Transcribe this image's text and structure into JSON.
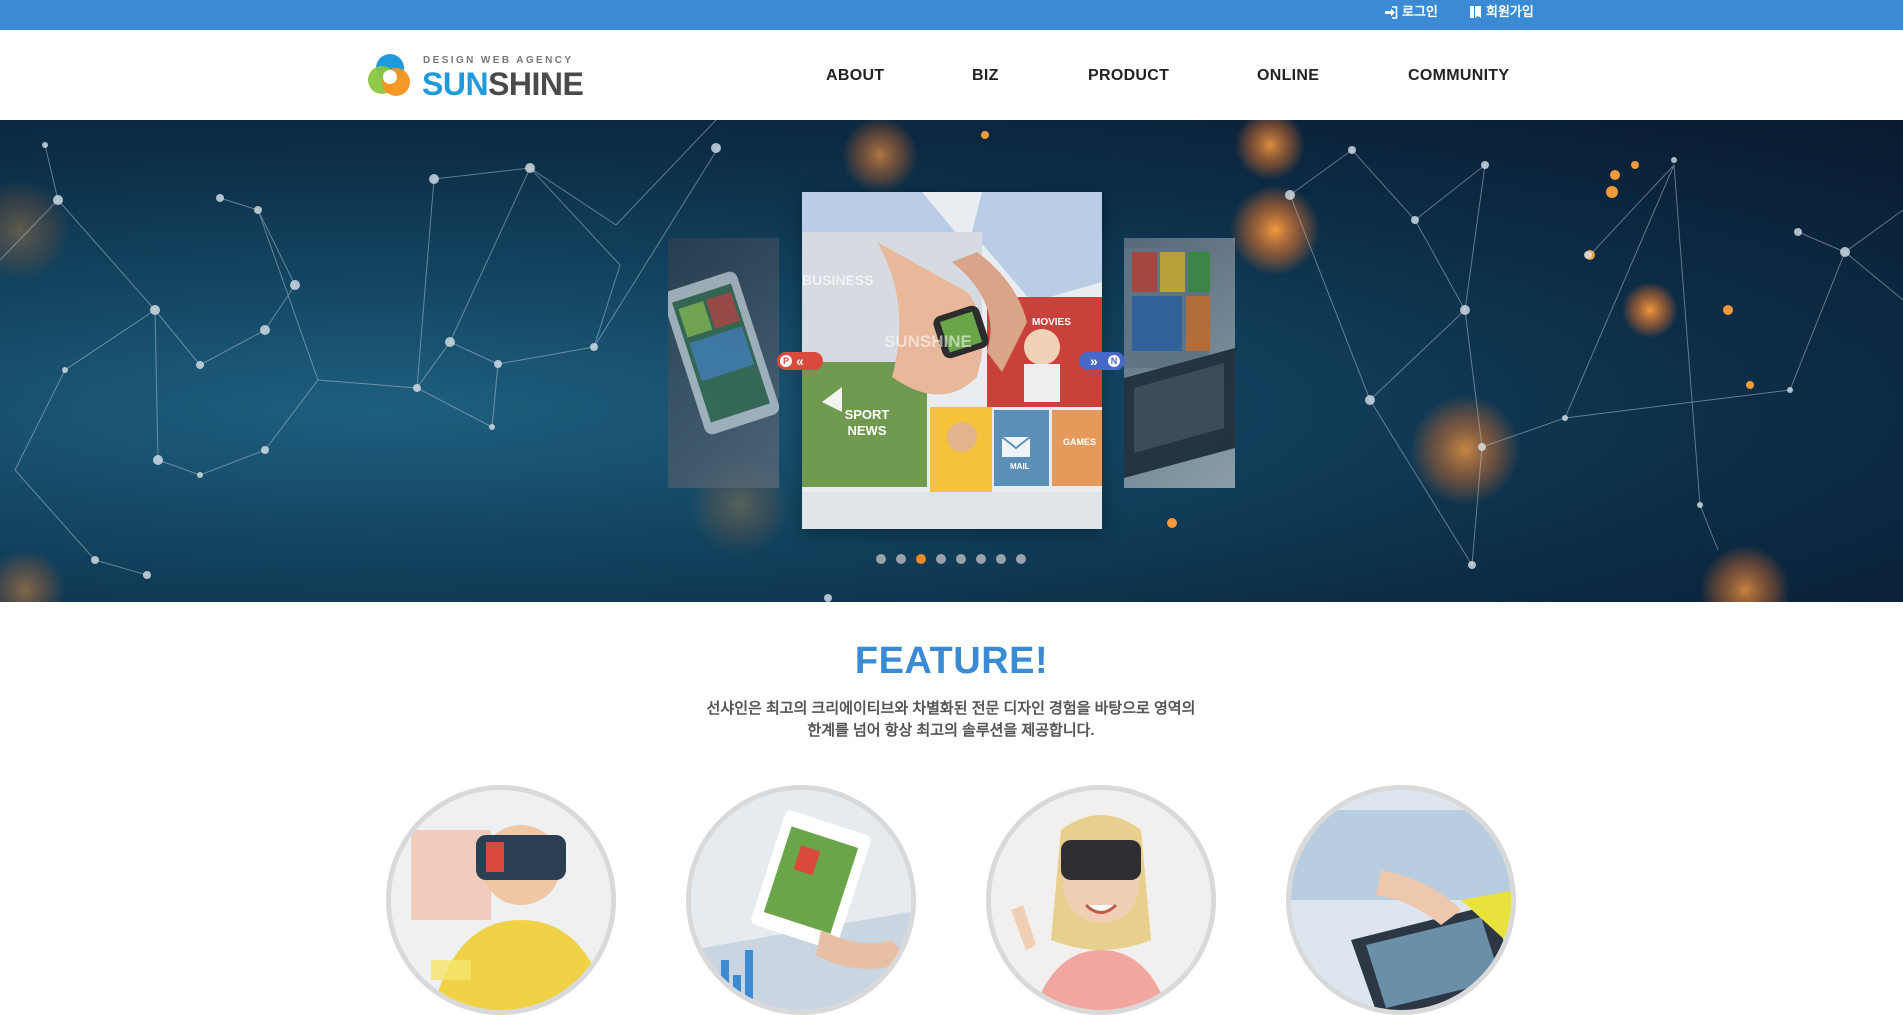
{
  "topbar": {
    "login_label": "로그인",
    "login_icon": "sign-in-icon",
    "signup_label": "회원가입",
    "signup_icon": "user-book-icon",
    "bg_color": "#3a8bd4"
  },
  "logo": {
    "tagline": "DESIGN WEB AGENCY",
    "word_part1": "SUN",
    "word_part2": "SHINE",
    "colors": {
      "sun": "#1f9bdc",
      "shine": "#4a4a4a"
    }
  },
  "nav": {
    "items": [
      "ABOUT",
      "BIZ",
      "PRODUCT",
      "ONLINE",
      "COMMUNITY"
    ]
  },
  "slider": {
    "prev_letter": "P",
    "next_letter": "N",
    "slide_labels": [
      "BUSINESS",
      "SUNSHINE",
      "MOVIES",
      "SPORT NEWS",
      "MAIL",
      "GAMES"
    ],
    "dot_count": 8,
    "active_dot": 3,
    "accent_color": "#f08a24"
  },
  "feature": {
    "title": "FEATURE!",
    "desc_line1": "선샤인은 최고의 크리에이티브와 차별화된 전문 디자인 경험을 바탕으로 영역의",
    "desc_line2": "한계를 넘어 항상 최고의 솔루션을 제공합니다.",
    "title_color": "#3a8bd4",
    "items": [
      "vr-man-image",
      "tablet-hands-image",
      "vr-woman-image",
      "tablet-table-image"
    ]
  }
}
